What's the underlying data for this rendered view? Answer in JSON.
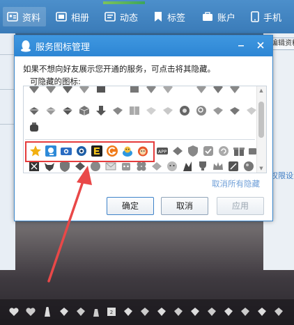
{
  "topnav": {
    "tabs": [
      {
        "label": "资料",
        "icon": "profile-card-icon",
        "active": true
      },
      {
        "label": "相册",
        "icon": "photo-album-icon",
        "active": false
      },
      {
        "label": "动态",
        "icon": "feed-icon",
        "active": false
      },
      {
        "label": "标签",
        "icon": "tag-icon",
        "active": false
      },
      {
        "label": "账户",
        "icon": "wallet-icon",
        "active": false
      },
      {
        "label": "手机",
        "icon": "phone-icon",
        "active": false
      }
    ]
  },
  "background": {
    "edit_button_label": "编辑资料",
    "permission_link": "权限设置"
  },
  "dialog": {
    "title": "服务图标管理",
    "description": "如果不想向好友展示您开通的服务，可点击将其隐藏。",
    "hideable_label": "可隐藏的图标:",
    "cancel_all_hidden": "取消所有隐藏",
    "buttons": {
      "confirm": "确定",
      "cancel": "取消",
      "apply": "应用"
    },
    "highlighted_icons": [
      "star-icon",
      "qzone-icon",
      "camera-icon",
      "eye-icon",
      "letter-e-icon",
      "orange-g-icon",
      "pet-icon",
      "monkey-icon"
    ]
  },
  "colors": {
    "titlebar": "#2d86d4",
    "highlight_border": "#e53b3b",
    "link": "#6f9fd8"
  }
}
